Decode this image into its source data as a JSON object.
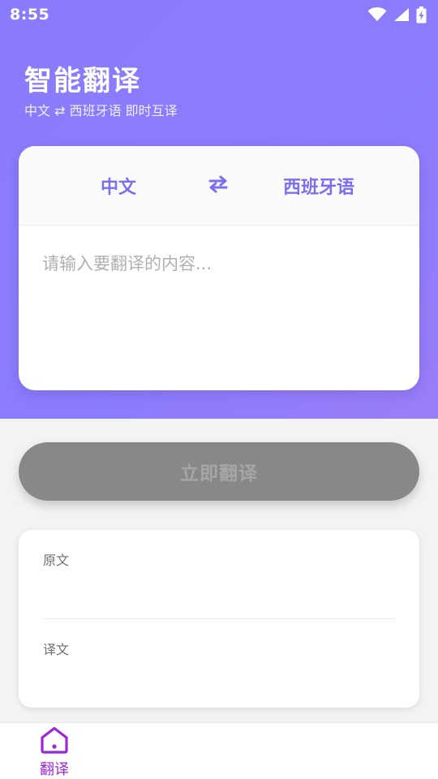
{
  "status_bar": {
    "time": "8:55",
    "icons": [
      "wifi-icon",
      "cellular-signal-icon",
      "battery-charging-icon"
    ]
  },
  "header": {
    "title": "智能翻译",
    "subtitle": "中文 ⇄ 西班牙语 即时互译"
  },
  "translator": {
    "source_language": "中文",
    "target_language": "西班牙语",
    "swap_icon": "swap-arrows-icon",
    "input_placeholder": "请输入要翻译的内容...",
    "input_value": ""
  },
  "actions": {
    "translate_label": "立即翻译"
  },
  "result": {
    "original_label": "原文",
    "original_text": "",
    "translated_label": "译文",
    "translated_text": ""
  },
  "bottom_nav": {
    "items": [
      {
        "label": "翻译",
        "icon": "home-icon",
        "active": true
      }
    ]
  },
  "colors": {
    "header_gradient_start": "#8a7bfb",
    "header_gradient_end": "#9a7cf8",
    "accent": "#7b6ff0",
    "nav_active": "#9c27d6",
    "button_disabled": "#888888",
    "background": "#f3f3f4"
  }
}
